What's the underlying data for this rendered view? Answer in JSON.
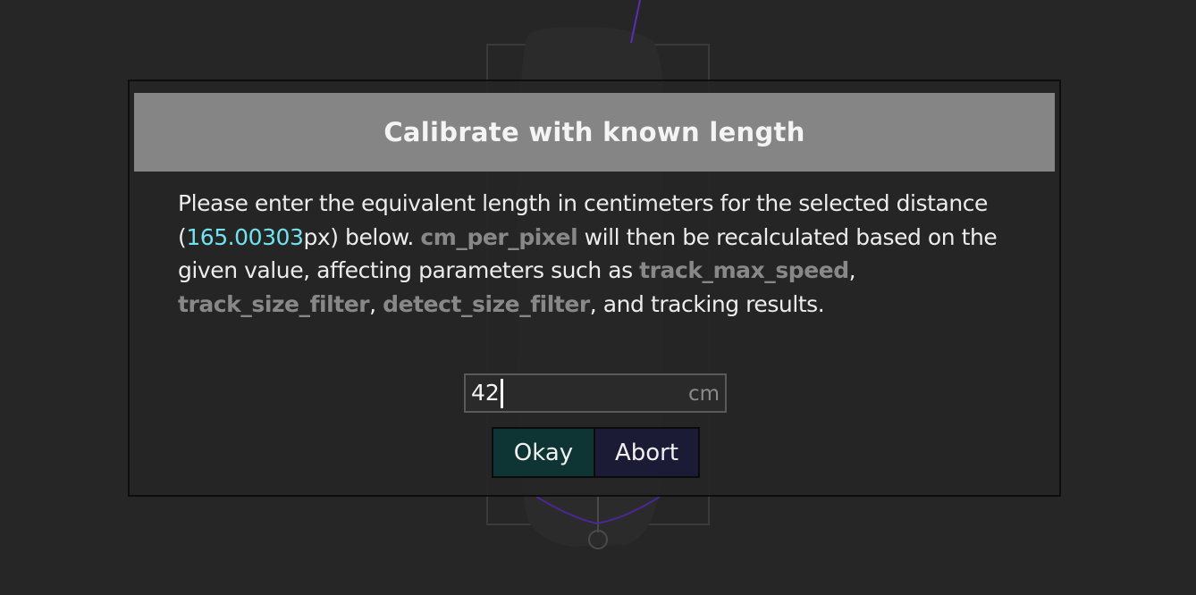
{
  "dialog": {
    "title": "Calibrate with known length",
    "message": {
      "part1": "Please enter the equivalent length in centimeters for the selected distance (",
      "distance_value": "165.00303",
      "part2": "px) below. ",
      "param_cm_per_pixel": "cm_per_pixel",
      "part3": " will then be recalculated based on the given value, affecting parameters such as ",
      "param_track_max_speed": "track_max_speed",
      "sep1": ", ",
      "param_track_size_filter": "track_size_filter",
      "sep2": ", ",
      "param_detect_size_filter": "detect_size_filter",
      "part4": ", and tracking results."
    },
    "length_input": {
      "value": "42",
      "unit": "cm"
    },
    "buttons": {
      "okay_label": "Okay",
      "abort_label": "Abort"
    }
  },
  "colors": {
    "background": "#262626",
    "header": "#858585",
    "highlight_value": "#6fe4ee",
    "param_text": "#888888",
    "okay_button": "#0f3434",
    "abort_button": "#1c1b36",
    "bg_outline": "#5d2bb8"
  }
}
